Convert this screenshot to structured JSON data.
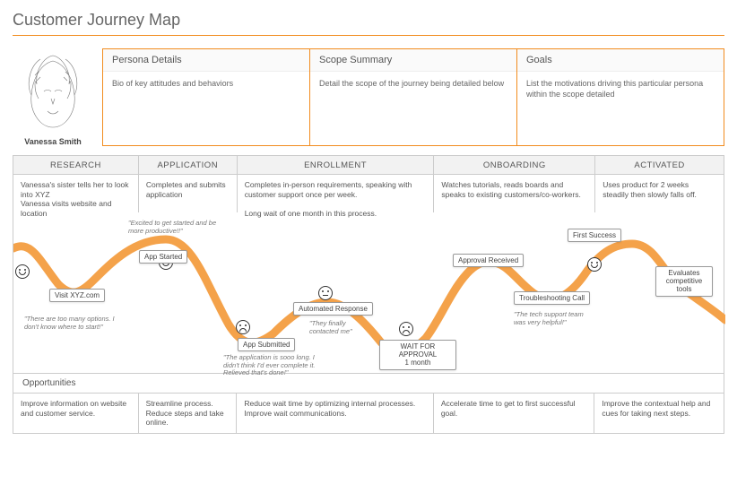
{
  "title": "Customer Journey Map",
  "persona": {
    "name": "Vanessa Smith"
  },
  "details": {
    "persona_head": "Persona Details",
    "persona_body": "Bio of key attitudes and behaviors",
    "scope_head": "Scope Summary",
    "scope_body": "Detail the scope of the journey being detailed below",
    "goals_head": "Goals",
    "goals_body": "List the motivations driving this particular persona within the scope detailed"
  },
  "phases": {
    "research": "RESEARCH",
    "application": "APPLICATION",
    "enrollment": "ENROLLMENT",
    "onboarding": "ONBOARDING",
    "activated": "ACTIVATED"
  },
  "desc": {
    "research": "Vanessa's sister tells her to look into XYZ\nVanessa visits website and location",
    "application": "Completes and submits application",
    "enrollment": "Completes in-person requirements, speaking with customer support once per week.\n\nLong wait of one month in this process.",
    "onboarding": "Watches tutorials, reads boards and speaks to existing customers/co-workers.",
    "activated": "Uses product for 2 weeks steadily then slowly falls off."
  },
  "touchpoints": {
    "visit": "Visit XYZ.com",
    "app_started": "App Started",
    "app_submitted": "App Submitted",
    "automated_response": "Automated Response",
    "wait_approval_line1": "WAIT FOR APPROVAL",
    "wait_approval_line2": "1 month",
    "approval_received": "Approval Received",
    "troubleshooting": "Troubleshooting Call",
    "first_success": "First Success",
    "evaluates_line1": "Evaluates",
    "evaluates_line2": "competitive tools"
  },
  "quotes": {
    "research": "\"There are too many options. I don't know where to start!\"",
    "application_top": "\"Excited to get started and be more productive!!\"",
    "application_bottom": "\"The application is sooo long. I didn't think I'd ever complete it. Relieved that's done!\"",
    "enrollment": "\"They finally contacted me\"",
    "onboarding": "\"The tech support team was very helpful!\""
  },
  "opportunities": {
    "heading": "Opportunities",
    "research": "Improve information on website and customer service.",
    "application": "Streamline process. Reduce steps and take online.",
    "enrollment": "Reduce wait time by optimizing internal processes. Improve wait communications.",
    "onboarding": "Accelerate time to get to first successful goal.",
    "activated": "Improve the contextual help and cues for taking next steps."
  }
}
